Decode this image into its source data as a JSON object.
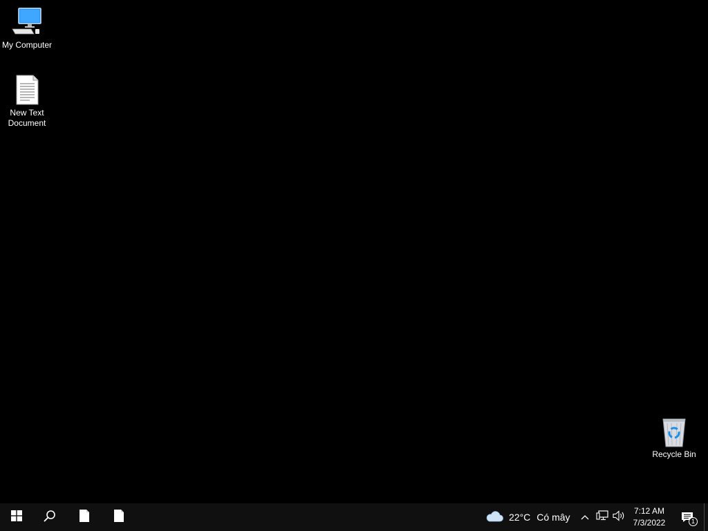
{
  "desktop": {
    "background_color": "#000000",
    "icons": [
      {
        "label": "My Computer",
        "icon": "computer-icon"
      },
      {
        "label": "New Text\nDocument",
        "icon": "text-document-icon"
      },
      {
        "label": "Recycle Bin",
        "icon": "recycle-bin-icon"
      }
    ]
  },
  "taskbar": {
    "background_color": "#101010",
    "start_icon": "windows-logo-icon",
    "search_icon": "search-icon",
    "pinned": [
      {
        "icon": "blank-document-icon"
      },
      {
        "icon": "blank-document-icon"
      }
    ],
    "weather": {
      "icon": "cloud-icon",
      "temperature": "22°C",
      "condition": "Có mây"
    },
    "tray": {
      "chevron_icon": "chevron-up-icon",
      "network_icon": "network-icon",
      "volume_icon": "volume-icon"
    },
    "clock": {
      "time": "7:12 AM",
      "date": "7/3/2022"
    },
    "notifications": {
      "icon": "notification-icon",
      "count": "1"
    }
  }
}
